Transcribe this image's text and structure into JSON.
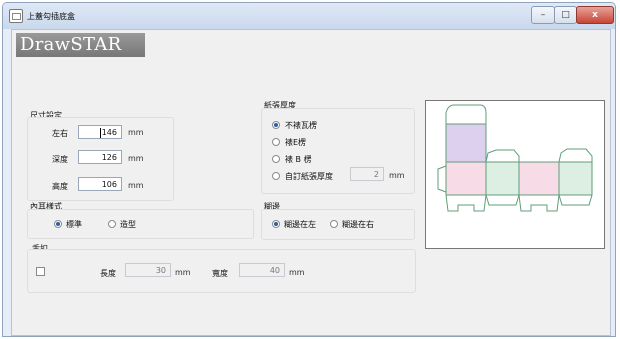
{
  "window": {
    "title": "上蓋勾插底盒",
    "brand": "DrawSTAR",
    "controls": {
      "minimize": "–",
      "maximize": "□",
      "close": "x"
    }
  },
  "size": {
    "label": "尺寸設定",
    "fields": [
      {
        "label": "左右",
        "value": "146",
        "unit": "mm"
      },
      {
        "label": "深度",
        "value": "126",
        "unit": "mm"
      },
      {
        "label": "高度",
        "value": "106",
        "unit": "mm"
      }
    ]
  },
  "ear": {
    "label": "內耳樣式",
    "options": [
      {
        "label": "標準",
        "selected": true
      },
      {
        "label": "造型",
        "selected": false
      }
    ]
  },
  "tongue": {
    "label": "舌扣",
    "length_label": "長度",
    "length_value": "30",
    "length_unit": "mm",
    "width_label": "寬度",
    "width_value": "40",
    "width_unit": "mm",
    "checked": false
  },
  "paper": {
    "label": "紙張厚度",
    "options": [
      {
        "label": "不裱瓦楞",
        "selected": true
      },
      {
        "label": "裱E楞",
        "selected": false
      },
      {
        "label": "裱 B 楞",
        "selected": false
      },
      {
        "label": "自訂紙張厚度",
        "selected": false
      }
    ],
    "custom_value": "2",
    "custom_unit": "mm"
  },
  "glue": {
    "label": "糊邊",
    "options": [
      {
        "label": "糊邊在左",
        "selected": true
      },
      {
        "label": "糊邊在右",
        "selected": false
      }
    ]
  },
  "colors": {
    "line": "#5f9e7a",
    "panel_purple": "#dcd0ee",
    "panel_pink": "#f7dbe6",
    "panel_green": "#dcefe2"
  }
}
